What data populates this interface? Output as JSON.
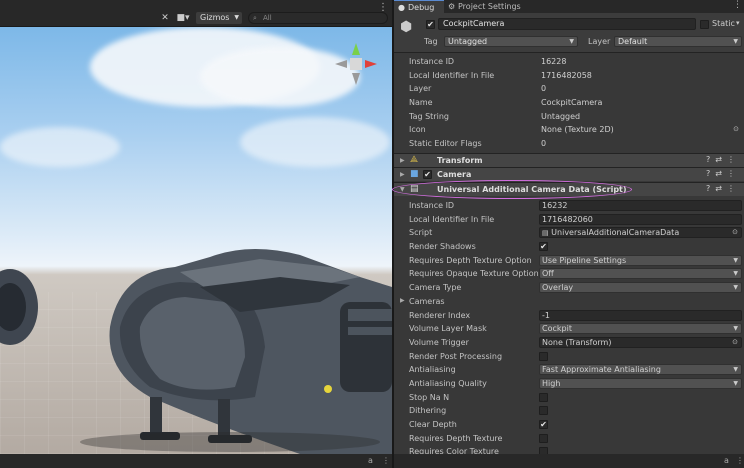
{
  "scene": {
    "toolbar": {
      "gizmos_label": "Gizmos",
      "search_placeholder": "All",
      "more": "⋮"
    },
    "status_icons": [
      "a",
      "⋮"
    ]
  },
  "inspector": {
    "tabs": [
      {
        "label": "Debug",
        "icon": "bug-icon",
        "active": true
      },
      {
        "label": "Project Settings",
        "icon": "gear-icon",
        "active": false
      }
    ],
    "more": "⋮",
    "gameobject": {
      "enabled_check": "✔",
      "name": "CockpitCamera",
      "static_label": "Static",
      "tag_label": "Tag",
      "tag_value": "Untagged",
      "layer_label": "Layer",
      "layer_value": "Default"
    },
    "properties": [
      {
        "name": "Instance ID",
        "value": "16228",
        "kind": "text"
      },
      {
        "name": "Local Identifier In File",
        "value": "1716482058",
        "kind": "text"
      },
      {
        "name": "Layer",
        "value": "0",
        "kind": "text"
      },
      {
        "name": "Name",
        "value": "CockpitCamera",
        "kind": "text"
      },
      {
        "name": "Tag String",
        "value": "Untagged",
        "kind": "text"
      },
      {
        "name": "Icon",
        "value": "None (Texture 2D)",
        "kind": "object"
      },
      {
        "name": "Static Editor Flags",
        "value": "0",
        "kind": "text"
      }
    ],
    "components": [
      {
        "name": "Transform",
        "icon": "transform-icon",
        "has_check": false
      },
      {
        "name": "Camera",
        "icon": "camera-icon",
        "has_check": true
      },
      {
        "name": "Universal Additional Camera Data (Script)",
        "icon": "script-icon",
        "has_check": false
      }
    ],
    "camera_data": [
      {
        "name": "Instance ID",
        "value": "16232",
        "kind": "field"
      },
      {
        "name": "Local Identifier In File",
        "value": "1716482060",
        "kind": "field"
      },
      {
        "name": "Script",
        "value": "UniversalAdditionalCameraData",
        "kind": "object"
      },
      {
        "name": "Render Shadows",
        "value": "✔",
        "kind": "check"
      },
      {
        "name": "Requires Depth Texture Option",
        "value": "Use Pipeline Settings",
        "kind": "drop"
      },
      {
        "name": "Requires Opaque Texture Option",
        "value": "Off",
        "kind": "drop"
      },
      {
        "name": "Camera Type",
        "value": "Overlay",
        "kind": "drop"
      },
      {
        "name": "Cameras",
        "value": "",
        "kind": "foldout"
      },
      {
        "name": "Renderer Index",
        "value": "-1",
        "kind": "field"
      },
      {
        "name": "Volume Layer Mask",
        "value": "Cockpit",
        "kind": "drop"
      },
      {
        "name": "Volume Trigger",
        "value": "None (Transform)",
        "kind": "object"
      },
      {
        "name": "Render Post Processing",
        "value": "",
        "kind": "check"
      },
      {
        "name": "Antialiasing",
        "value": "Fast Approximate Antialiasing",
        "kind": "drop"
      },
      {
        "name": "Antialiasing Quality",
        "value": "High",
        "kind": "drop"
      },
      {
        "name": "Stop Na N",
        "value": "",
        "kind": "check"
      },
      {
        "name": "Dithering",
        "value": "",
        "kind": "check"
      },
      {
        "name": "Clear Depth",
        "value": "✔",
        "kind": "check"
      },
      {
        "name": "Requires Depth Texture",
        "value": "",
        "kind": "check"
      },
      {
        "name": "Requires Color Texture",
        "value": "",
        "kind": "check"
      }
    ],
    "status_icons": [
      "a",
      "⋮"
    ],
    "highlight_color": "#d36ee0"
  }
}
